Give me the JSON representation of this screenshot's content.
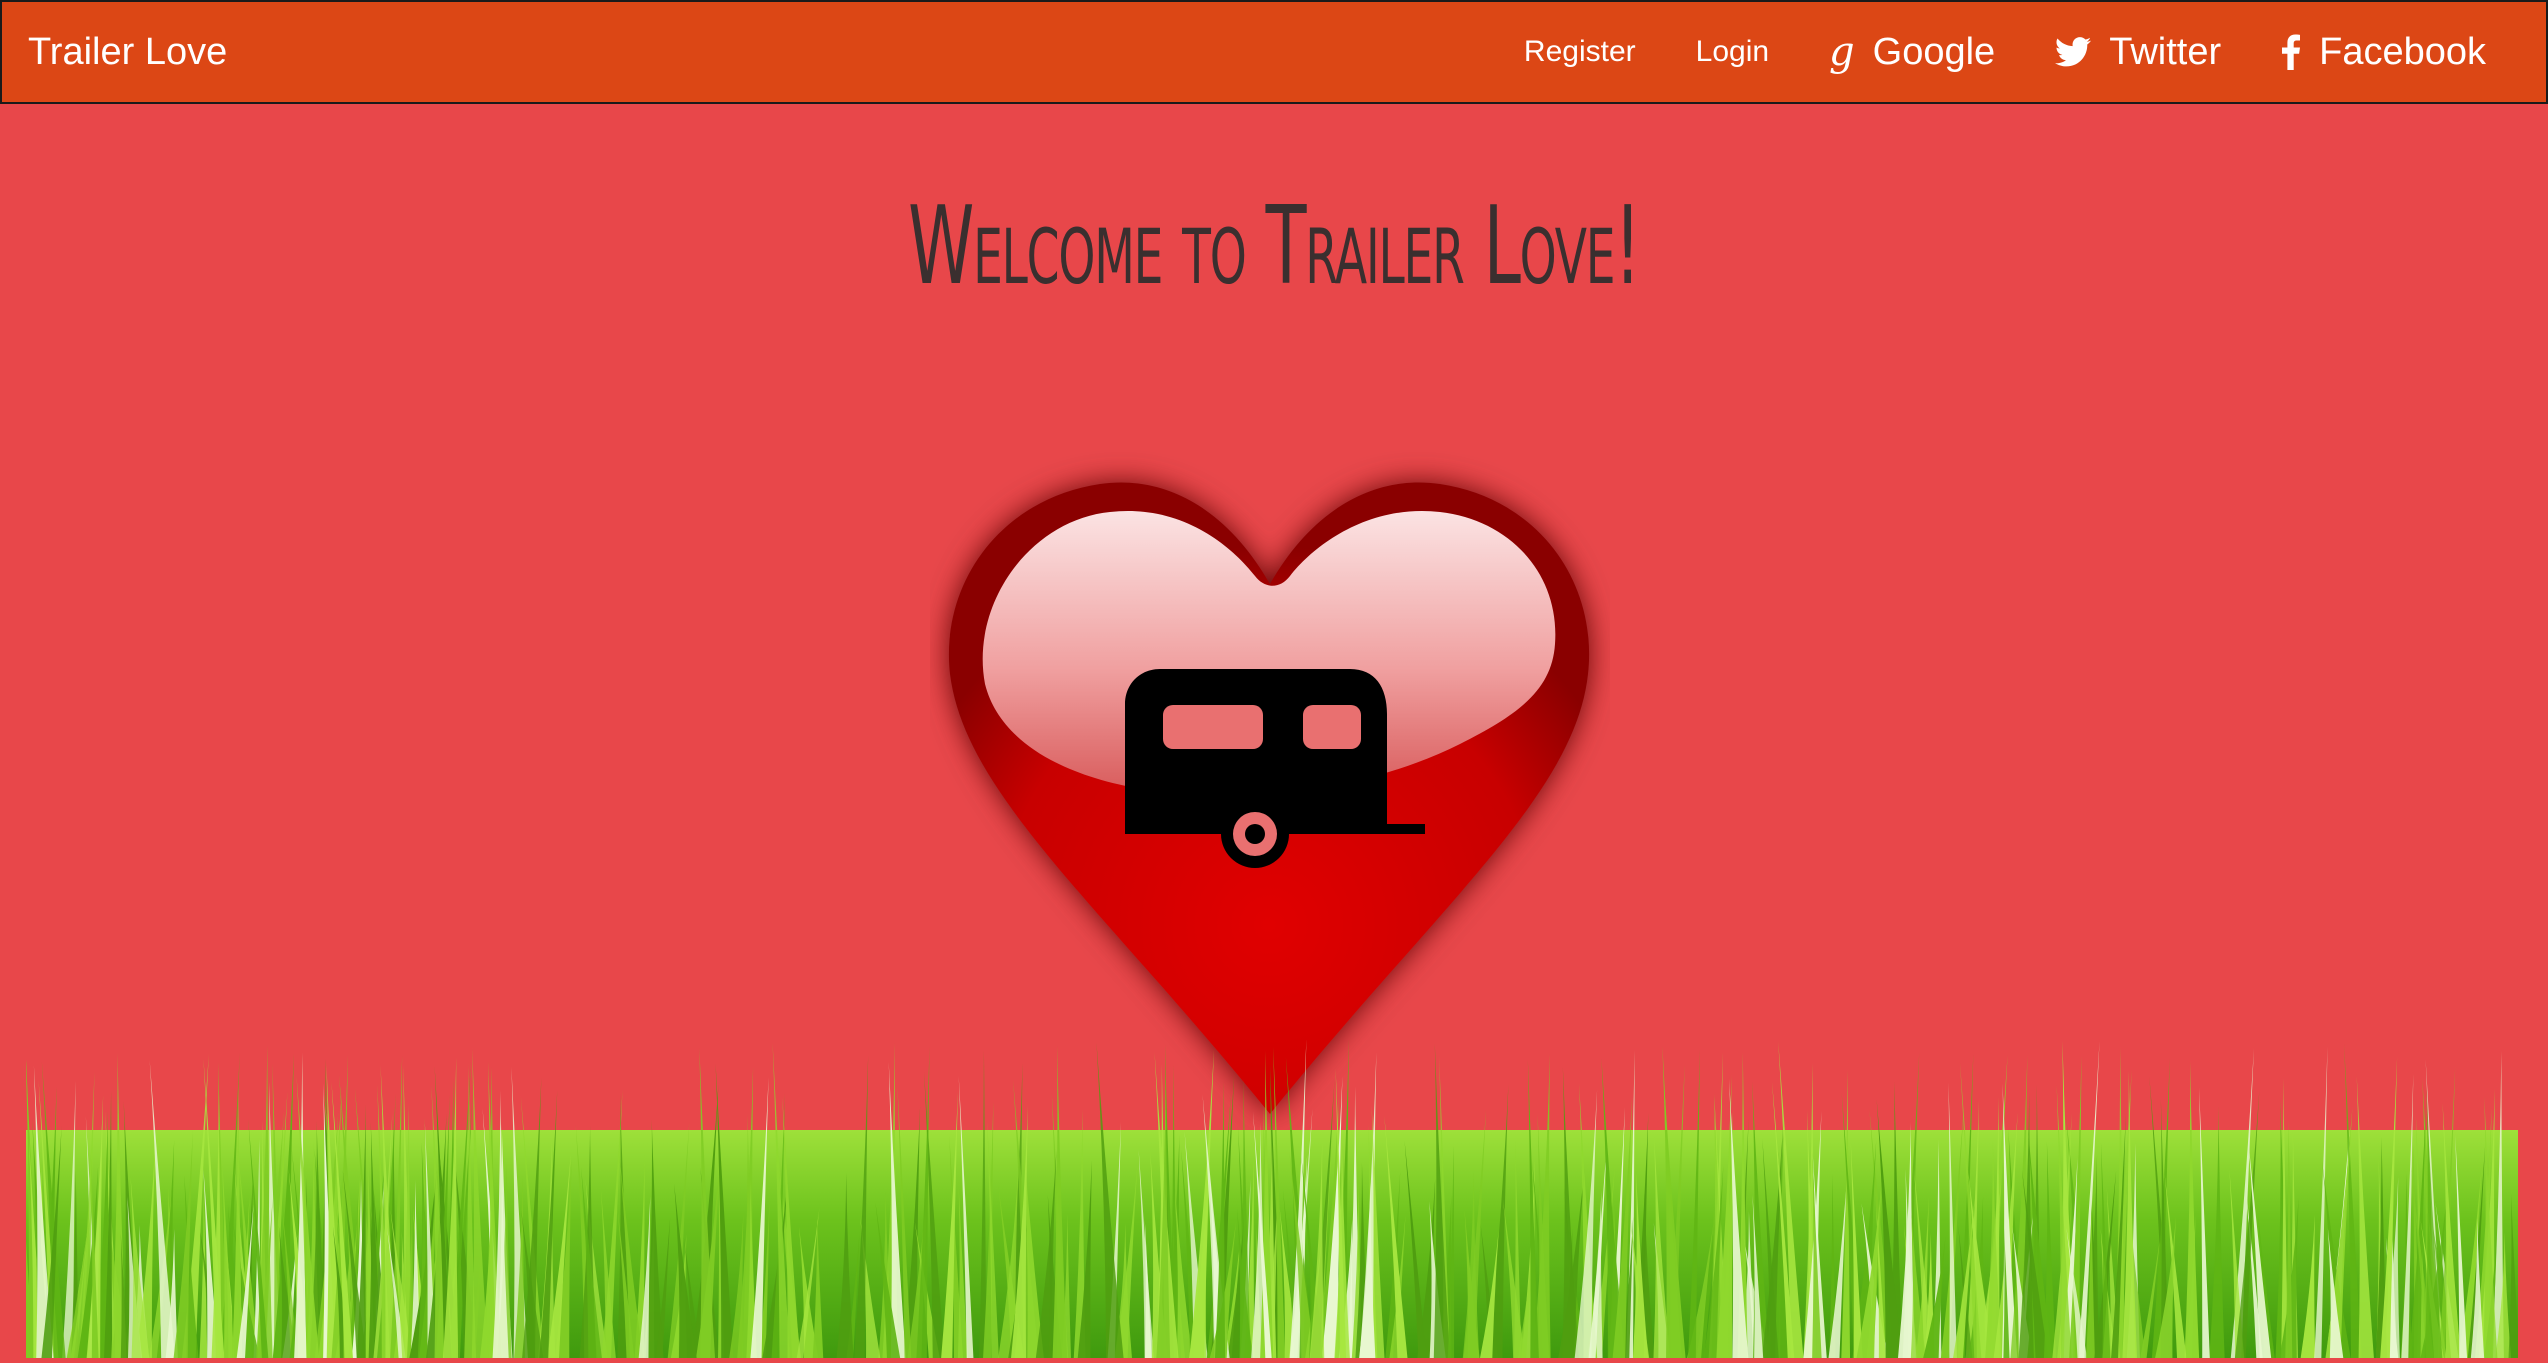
{
  "nav": {
    "brand": "Trailer Love",
    "register": "Register",
    "login": "Login",
    "google": "Google",
    "twitter": "Twitter",
    "facebook": "Facebook"
  },
  "hero": {
    "title": "Welcome to Trailer Love!"
  },
  "icons": [
    "google-icon",
    "twitter-icon",
    "facebook-icon",
    "heart-trailer-logo",
    "grass-image"
  ],
  "colors": {
    "navbar": "#dc4715",
    "background": "#e8474a",
    "title": "#3a2f2f",
    "heart": "#d40000"
  }
}
